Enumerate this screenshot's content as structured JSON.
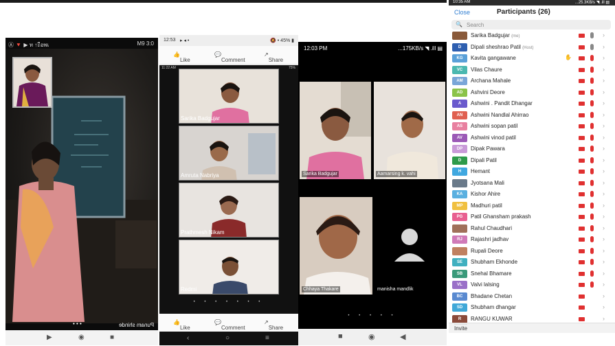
{
  "panel1": {
    "status": {
      "left": "Ⓐ 🔻 ▶ ท ↑ะือพเ",
      "right": "M9 3:0"
    },
    "caption": "Punam shinde",
    "dots": "• • •",
    "nav": {
      "play": "▶",
      "home": "◉",
      "stop": "■"
    }
  },
  "panel2": {
    "status": {
      "time": "12:53",
      "icons": "▸ ◂ •",
      "right": "🔕 • 45% ▮"
    },
    "actions": {
      "like": "Like",
      "comment": "Comment",
      "share": "Share"
    },
    "inner_status": {
      "time": "11:22 AM",
      "right": "75%"
    },
    "tiles": [
      {
        "name": "Sarika Badgujar"
      },
      {
        "name": "Amruta Nabriya"
      },
      {
        "name": "Prathmesh Nikam"
      },
      {
        "name": "Redmi"
      }
    ],
    "dots": "• • • • • • •",
    "nav": {
      "back": "‹",
      "home": "○",
      "menu": "≡"
    }
  },
  "panel3": {
    "status": {
      "time": "12:03 PM",
      "right": "...175KB/s ◥ .ill ▤"
    },
    "tiles": [
      {
        "name": "Sarika Badgujar"
      },
      {
        "name": "Aamarsing k. vahi"
      },
      {
        "name": "Chhaya Thakare"
      },
      {
        "name": "manisha mandlik"
      }
    ],
    "dots": "• • • • •",
    "nav": {
      "stop": "■",
      "home": "◉",
      "back": "◀"
    }
  },
  "panel4": {
    "status": {
      "time": "10:35 AM",
      "right": "...25.3KB/s ◥ .ill ▤"
    },
    "close_label": "Close",
    "title": "Participants (26)",
    "search_placeholder": "Search",
    "participants": [
      {
        "initials": "",
        "name": "Sarika Badgujar",
        "role": "(me)",
        "color": "#8a5a3a",
        "mic": "gray"
      },
      {
        "initials": "D",
        "name": "Dipali sheshrao Patil",
        "role": "(Host)",
        "color": "#2e5fb0",
        "mic": "gray"
      },
      {
        "initials": "KG",
        "name": "Kavita gangawane",
        "role": "",
        "color": "#5aa0d8",
        "mic": "red",
        "hand": true
      },
      {
        "initials": "VC",
        "name": "Vilas Chaure",
        "role": "",
        "color": "#4bb8b0",
        "mic": "red"
      },
      {
        "initials": "AM",
        "name": "Archana Mahale",
        "role": "",
        "color": "#7aa6d8",
        "mic": "red"
      },
      {
        "initials": "AD",
        "name": "Ashvini Deore",
        "role": "",
        "color": "#8bc34a",
        "mic": "red"
      },
      {
        "initials": "A",
        "name": "Ashwini . Pandit Dhangar",
        "role": "",
        "color": "#6a5acd",
        "mic": "red"
      },
      {
        "initials": "AN",
        "name": "Ashwini Nandlal Ahirrao",
        "role": "",
        "color": "#e06050",
        "mic": "red"
      },
      {
        "initials": "AS",
        "name": "Ashwini sopan patil",
        "role": "",
        "color": "#e880a0",
        "mic": "red"
      },
      {
        "initials": "AV",
        "name": "Ashwini vinod patil",
        "role": "",
        "color": "#9b59b6",
        "mic": "red"
      },
      {
        "initials": "DP",
        "name": "Dipak Pawara",
        "role": "",
        "color": "#c99ad8",
        "mic": "red"
      },
      {
        "initials": "D",
        "name": "Dipali Patil",
        "role": "",
        "color": "#2e9a4a",
        "mic": "red"
      },
      {
        "initials": "H",
        "name": "Hemant",
        "role": "",
        "color": "#40a8e0",
        "mic": "red"
      },
      {
        "initials": "",
        "name": "Jyotsana Mali",
        "role": "",
        "color": "#6a7a8a",
        "mic": "red"
      },
      {
        "initials": "KA",
        "name": "Kishor Ahire",
        "role": "",
        "color": "#5ab0e0",
        "mic": "red"
      },
      {
        "initials": "MP",
        "name": "Madhuri patil",
        "role": "",
        "color": "#f0c040",
        "mic": "red"
      },
      {
        "initials": "PG",
        "name": "Patil Ghansham prakash",
        "role": "",
        "color": "#e86090",
        "mic": "red"
      },
      {
        "initials": "",
        "name": "Rahul Chaudhari",
        "role": "",
        "color": "#a0705a",
        "mic": "red"
      },
      {
        "initials": "RJ",
        "name": "Rajashri jadhav",
        "role": "",
        "color": "#d07ab8",
        "mic": "red"
      },
      {
        "initials": "",
        "name": "Rupali Deore",
        "role": "",
        "color": "#c08060",
        "mic": "red"
      },
      {
        "initials": "SE",
        "name": "Shubham Ekhonde",
        "role": "",
        "color": "#40b0c0",
        "mic": "red"
      },
      {
        "initials": "SB",
        "name": "Snehal Bhamare",
        "role": "",
        "color": "#3a9a7a",
        "mic": "red"
      },
      {
        "initials": "VL",
        "name": "Valvi lalsing",
        "role": "",
        "color": "#9a70c8",
        "mic": "red"
      },
      {
        "initials": "BC",
        "name": "Bhadane Chetan",
        "role": "",
        "color": "#5a8ad0",
        "mic": "none"
      },
      {
        "initials": "SD",
        "name": "Shubham dhangar",
        "role": "",
        "color": "#40a8d8",
        "mic": "none"
      },
      {
        "initials": "R",
        "name": "RANGU KUWAR",
        "role": "",
        "color": "#8a4a3a",
        "mic": "none"
      }
    ],
    "invite_label": "Invite"
  }
}
